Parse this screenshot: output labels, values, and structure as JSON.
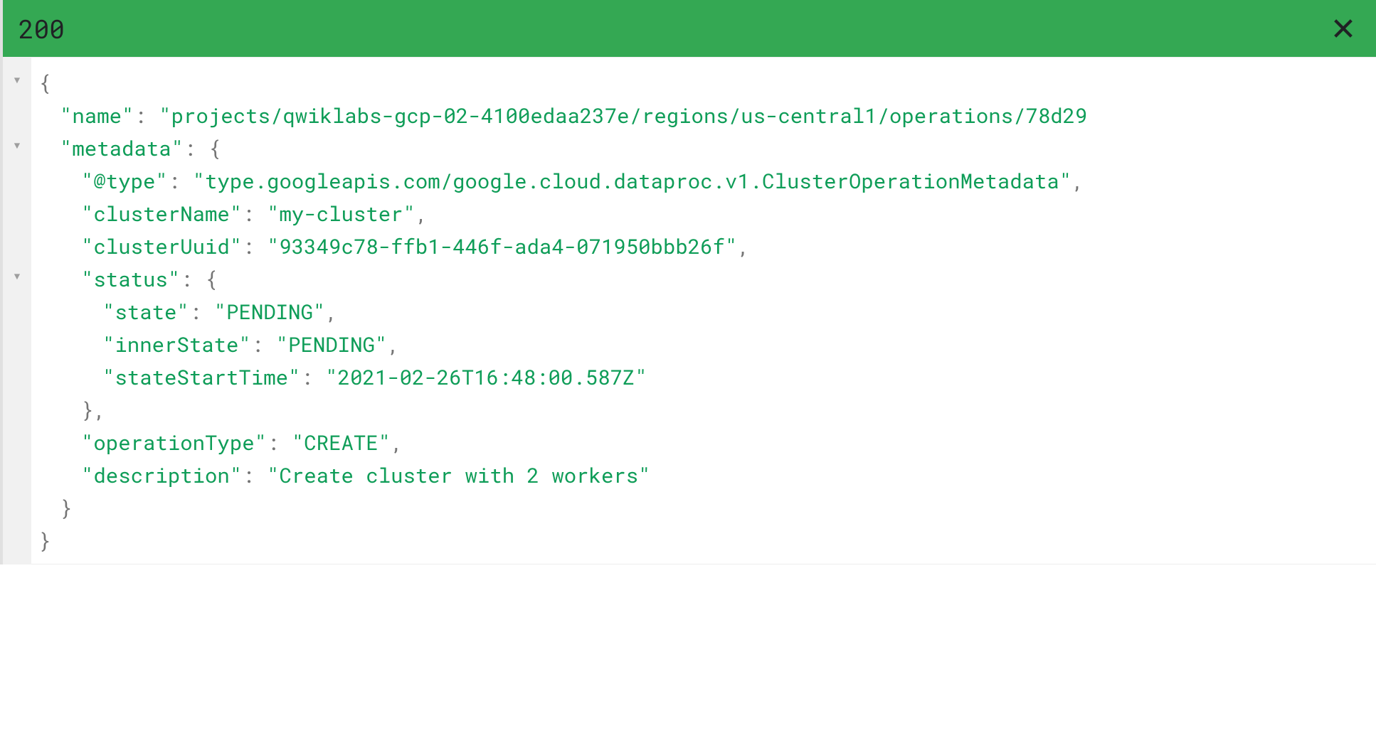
{
  "header": {
    "status_code": "200"
  },
  "json": {
    "open": "{",
    "name_key": "\"name\"",
    "name_val": "\"projects/qwiklabs-gcp-02-4100edaa237e/regions/us-central1/operations/78d29",
    "metadata_key": "\"metadata\"",
    "metadata_open": "{",
    "type_key": "\"@type\"",
    "type_val": "\"type.googleapis.com/google.cloud.dataproc.v1.ClusterOperationMetadata\"",
    "clusterName_key": "\"clusterName\"",
    "clusterName_val": "\"my-cluster\"",
    "clusterUuid_key": "\"clusterUuid\"",
    "clusterUuid_val": "\"93349c78-ffb1-446f-ada4-071950bbb26f\"",
    "status_key": "\"status\"",
    "status_open": "{",
    "state_key": "\"state\"",
    "state_val": "\"PENDING\"",
    "innerState_key": "\"innerState\"",
    "innerState_val": "\"PENDING\"",
    "stateStartTime_key": "\"stateStartTime\"",
    "stateStartTime_val": "\"2021-02-26T16:48:00.587Z\"",
    "status_close": "}",
    "operationType_key": "\"operationType\"",
    "operationType_val": "\"CREATE\"",
    "description_key": "\"description\"",
    "description_val": "\"Create cluster with 2 workers\"",
    "metadata_close": "}",
    "close": "}",
    "colon": ":",
    "comma": ","
  },
  "gutter": {
    "tri": "▼"
  }
}
